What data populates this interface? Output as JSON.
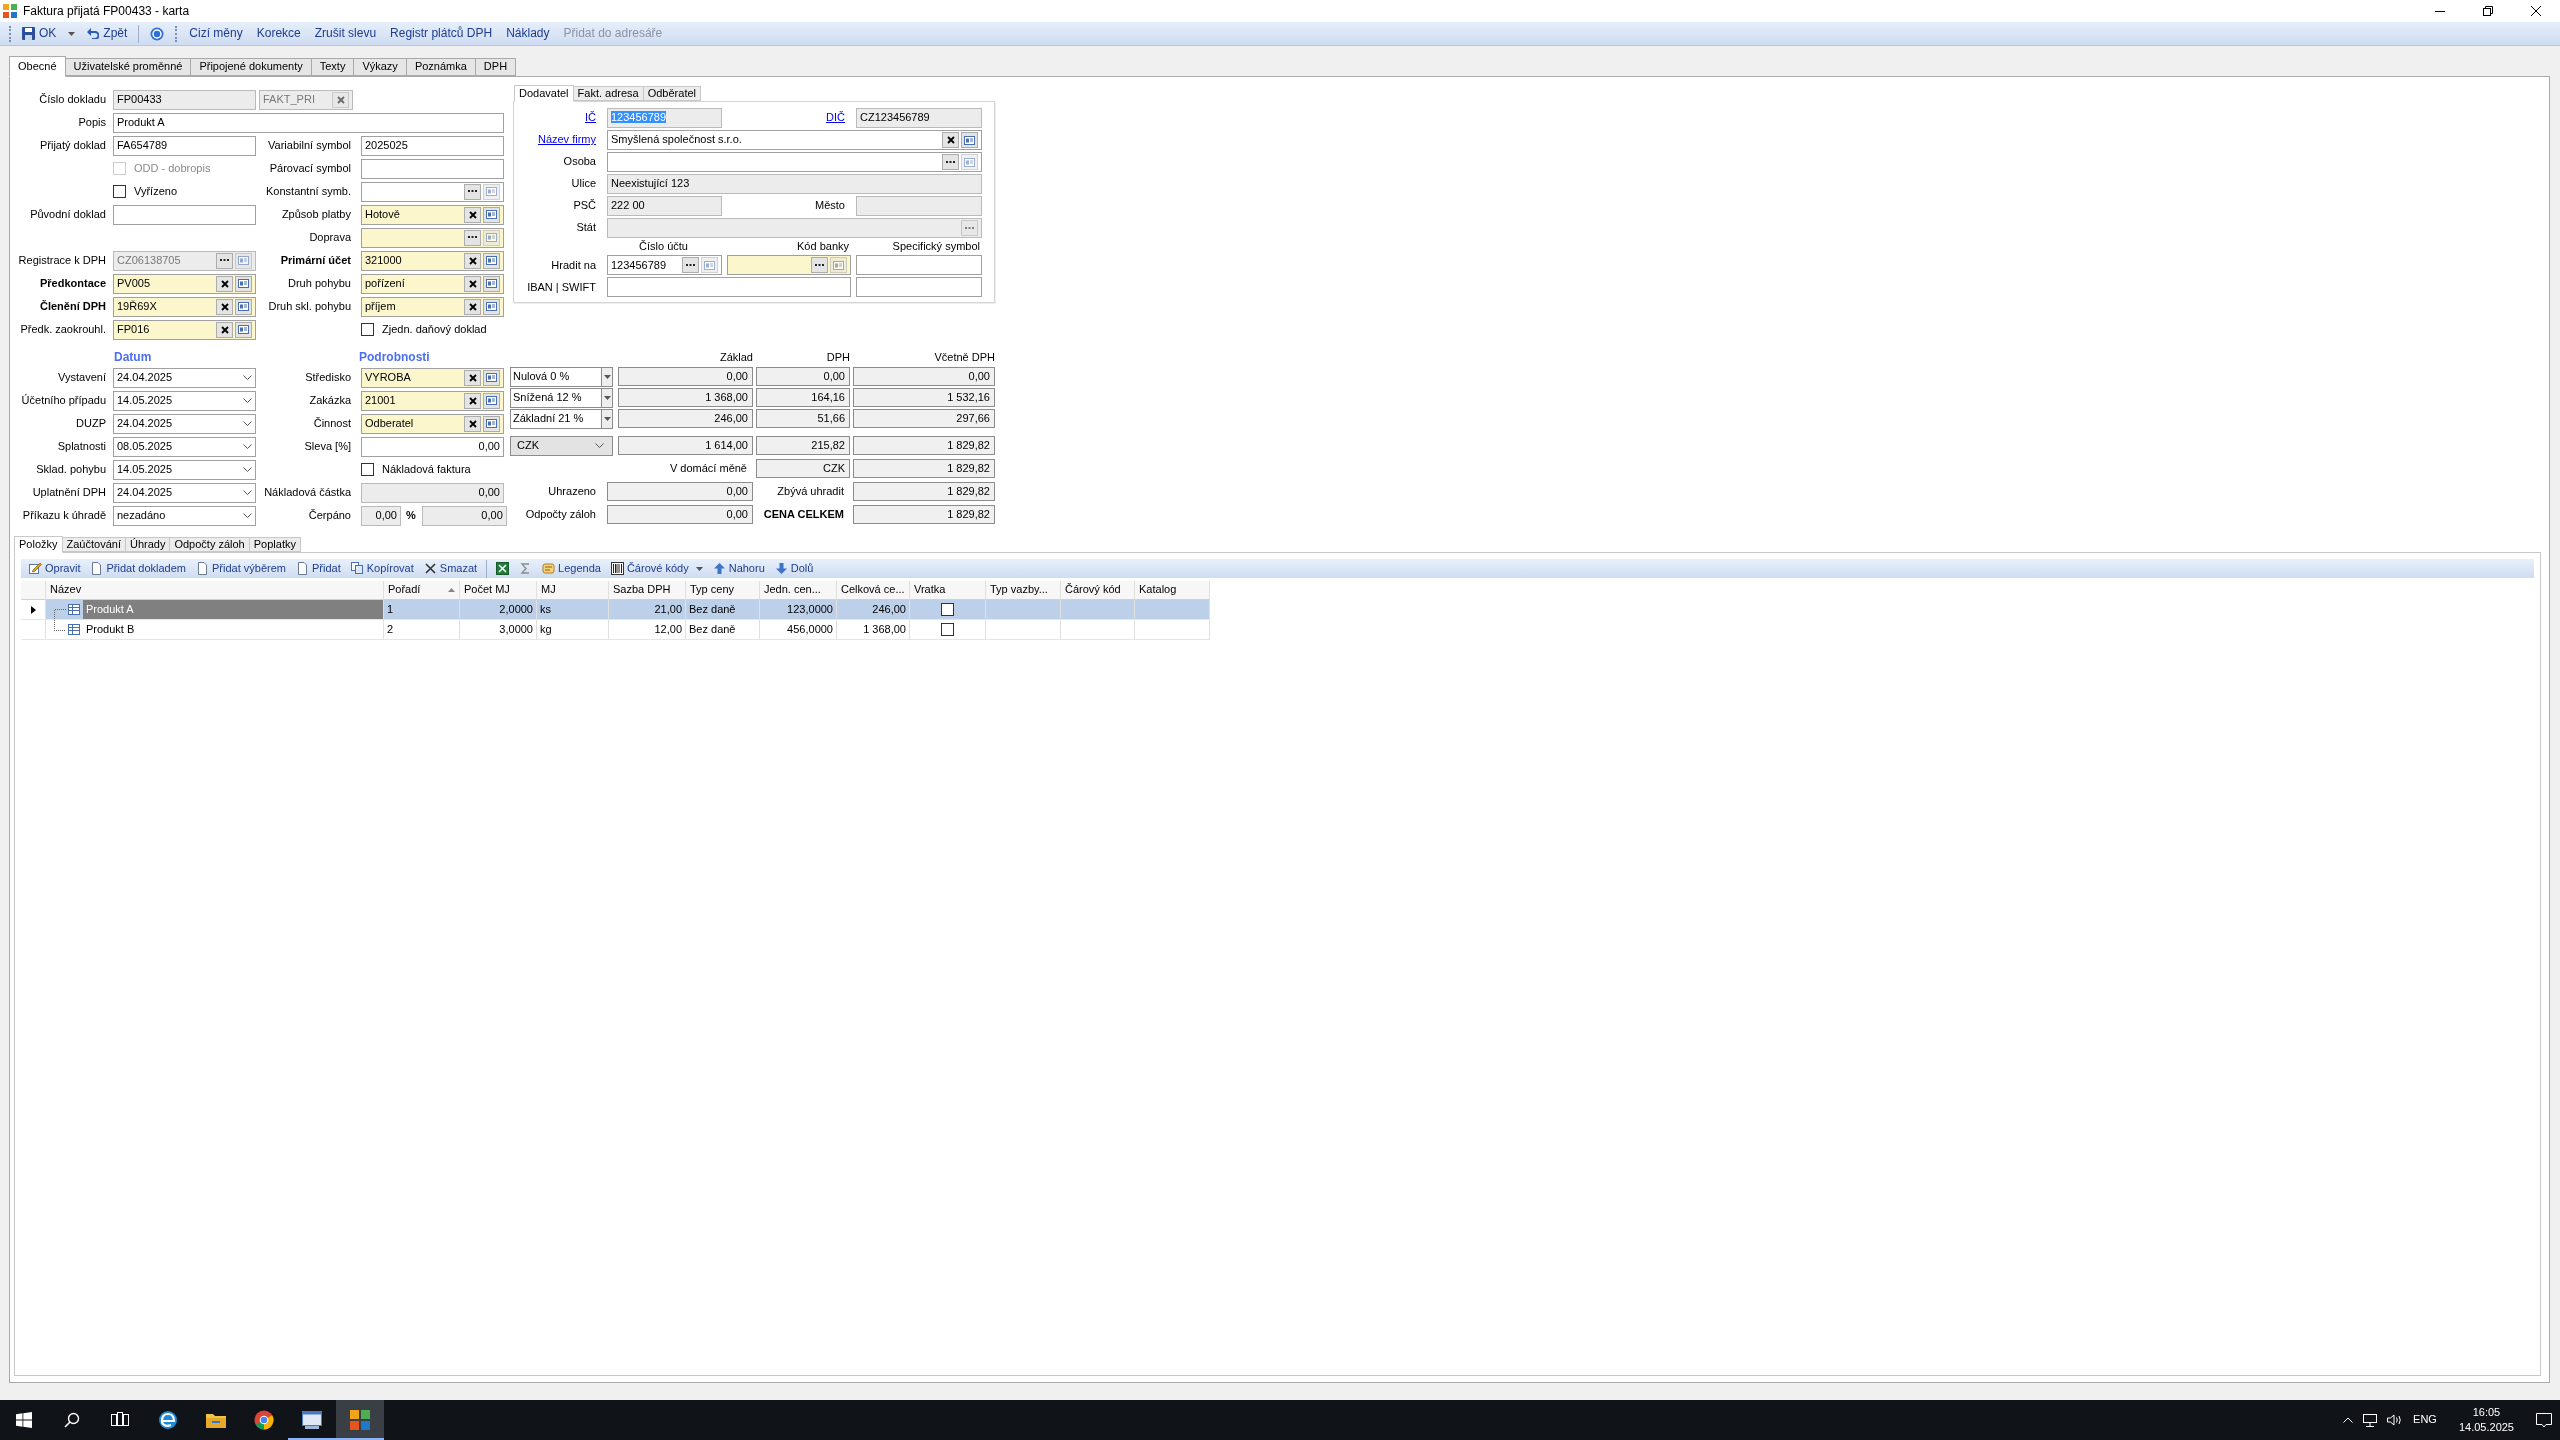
{
  "window": {
    "title": "Faktura přijatá FP00433 - karta"
  },
  "toolbar": {
    "items": [
      {
        "kind": "save",
        "label": "OK"
      },
      {
        "kind": "dropdown"
      },
      {
        "kind": "undo",
        "label": "Zpět"
      },
      {
        "kind": "help"
      }
    ],
    "actions": [
      {
        "label": "Cizí měny",
        "disabled": false
      },
      {
        "label": "Korekce",
        "disabled": false
      },
      {
        "label": "Zrušit slevu",
        "disabled": false
      },
      {
        "label": "Registr plátců DPH",
        "disabled": false
      },
      {
        "label": "Náklady",
        "disabled": false
      },
      {
        "label": "Přidat do adresáře",
        "disabled": true
      }
    ]
  },
  "tabs": [
    {
      "label": "Obecné",
      "selected": true
    },
    {
      "label": "Uživatelské proměnné",
      "selected": false
    },
    {
      "label": "Připojené dokumenty",
      "selected": false
    },
    {
      "label": "Texty",
      "selected": false
    },
    {
      "label": "Výkazy",
      "selected": false
    },
    {
      "label": "Poznámka",
      "selected": false
    },
    {
      "label": "DPH",
      "selected": false
    }
  ],
  "document": {
    "number": {
      "label": "Číslo dokladu",
      "value": "FP00433",
      "series": "FAKT_PRI"
    },
    "description": {
      "label": "Popis",
      "value": "Produkt A"
    },
    "rows": [
      {
        "left": {
          "label": "Přijatý doklad",
          "value": "FA654789",
          "kind": "text",
          "required": false,
          "readonly": false,
          "bold": false
        },
        "right": {
          "label": "Variabilní symbol",
          "value": "2025025",
          "kind": "text",
          "required": false,
          "readonly": false,
          "bold": false
        }
      },
      {
        "left": {
          "label": "ODD - dobropis",
          "kind": "checkbox",
          "checked": false,
          "disabled": true
        },
        "right": {
          "label": "Párovací symbol",
          "kind": "text",
          "required": false,
          "readonly": false,
          "bold": false
        }
      },
      {
        "left": {
          "label": "Vyřízeno",
          "kind": "checkbox",
          "checked": false,
          "disabled": false
        },
        "right": {
          "label": "Konstantní symb.",
          "kind": "browsable",
          "required": false,
          "readonly": false,
          "bold": false
        }
      },
      {
        "left": {
          "label": "Původní doklad",
          "kind": "text",
          "required": false,
          "readonly": false,
          "bold": false
        },
        "right": {
          "label": "Způsob platby",
          "value": "Hotově",
          "kind": "clearable",
          "required": true,
          "readonly": false,
          "bold": false
        }
      },
      {
        "right": {
          "label": "Doprava",
          "kind": "browsable",
          "required": true,
          "readonly": false,
          "bold": false
        }
      },
      {
        "left": {
          "label": "Registrace k DPH",
          "value": "CZ06138705",
          "kind": "browsable",
          "required": false,
          "readonly": true,
          "disabled": true,
          "bold": false
        },
        "right": {
          "label": "Primární účet",
          "value": "321000",
          "kind": "clearable",
          "required": true,
          "readonly": false,
          "bold": true
        }
      },
      {
        "left": {
          "label": "Předkontace",
          "value": "PV005",
          "kind": "clearable",
          "required": true,
          "readonly": false,
          "bold": true
        },
        "right": {
          "label": "Druh pohybu",
          "value": "pořízení",
          "kind": "clearable",
          "required": true,
          "readonly": false,
          "bold": false
        }
      },
      {
        "left": {
          "label": "Členění DPH",
          "value": "19Ř69X",
          "kind": "clearable",
          "required": true,
          "readonly": false,
          "bold": true
        },
        "right": {
          "label": "Druh skl. pohybu",
          "value": "příjem",
          "kind": "clearable",
          "required": true,
          "readonly": false,
          "bold": false
        }
      },
      {
        "left": {
          "label": "Předk. zaokrouhl.",
          "value": "FP016",
          "kind": "clearable",
          "required": true,
          "readonly": false,
          "bold": false
        },
        "right": {
          "label": "Zjedn. daňový doklad",
          "kind": "checkbox",
          "checked": false,
          "disabled": false
        }
      }
    ],
    "headings": [
      "Datum",
      "Podrobnosti"
    ],
    "detail_rows": [
      {
        "left": {
          "label": "Vystavení",
          "value": "24.04.2025",
          "kind": "date",
          "bold": false
        },
        "right": {
          "label": "Středisko",
          "value": "VYROBA",
          "kind": "clearable",
          "required": true,
          "readonly": false,
          "bold": false
        }
      },
      {
        "left": {
          "label": "Účetního případu",
          "value": "14.05.2025",
          "kind": "date",
          "bold": false
        },
        "right": {
          "label": "Zakázka",
          "value": "21001",
          "kind": "clearable",
          "required": true,
          "readonly": false,
          "bold": false
        }
      },
      {
        "left": {
          "label": "DUZP",
          "value": "24.04.2025",
          "kind": "date",
          "bold": false
        },
        "right": {
          "label": "Činnost",
          "value": "Odberatel",
          "kind": "clearable",
          "required": true,
          "readonly": false,
          "bold": false
        }
      },
      {
        "left": {
          "label": "Splatnosti",
          "value": "08.05.2025",
          "kind": "date",
          "bold": false
        },
        "right": {
          "label": "Sleva [%]",
          "value": "0,00",
          "kind": "number",
          "required": false,
          "readonly": false,
          "bold": false
        }
      },
      {
        "left": {
          "label": "Sklad. pohybu",
          "value": "14.05.2025",
          "kind": "date",
          "bold": false
        },
        "right": {
          "label": "Nákladová faktura",
          "kind": "checkbox",
          "checked": false,
          "disabled": false
        }
      },
      {
        "left": {
          "label": "Uplatnění DPH",
          "value": "24.04.2025",
          "kind": "date",
          "bold": false
        },
        "right": {
          "label": "Nákladová částka",
          "value": "0,00",
          "kind": "number",
          "required": false,
          "readonly": true,
          "bold": false
        }
      },
      {
        "left": {
          "label": "Příkazu k úhradě",
          "value": "nezadáno",
          "kind": "date",
          "bold": false
        },
        "right": {
          "label": "Čerpáno",
          "value": "0,00",
          "unit": "%",
          "amount": "0,00",
          "kind": "percent",
          "bold": false
        }
      }
    ]
  },
  "supplier_panel": {
    "tabs": [
      {
        "label": "Dodavatel",
        "selected": true
      },
      {
        "label": "Fakt. adresa",
        "selected": false
      },
      {
        "label": "Odběratel",
        "selected": false
      }
    ],
    "ic": {
      "label": "IČ",
      "value": "123456789",
      "kind": "text",
      "required": false,
      "readonly": true,
      "link": true,
      "highlighted": true
    },
    "dic": {
      "label": "DIČ",
      "value": "CZ123456789",
      "kind": "text",
      "required": false,
      "readonly": true,
      "link": true
    },
    "company": {
      "label": "Název firmy",
      "value": "Smyšlená společnost s.r.o.",
      "kind": "clearable",
      "required": false,
      "readonly": false,
      "link": true
    },
    "person": {
      "label": "Osoba",
      "kind": "browsable",
      "required": false,
      "readonly": false,
      "link": false
    },
    "street": {
      "label": "Ulice",
      "value": "Neexistující 123",
      "kind": "text",
      "required": false,
      "readonly": true,
      "link": false
    },
    "zip": {
      "label": "PSČ",
      "value": "222 00",
      "kind": "text",
      "required": false,
      "readonly": true,
      "link": false
    },
    "city": {
      "label": "Město",
      "kind": "text",
      "required": false,
      "readonly": true,
      "link": false
    },
    "country": {
      "label": "Stát",
      "kind": "ellipsis",
      "required": false,
      "readonly": true,
      "link": false
    },
    "bank_headers": [
      "Číslo účtu",
      "Kód banky",
      "Specifický symbol"
    ],
    "pay_to": {
      "label": "Hradit na",
      "account": {
        "value": "123456789",
        "kind": "browsable",
        "required": false,
        "readonly": false
      },
      "bank_code": {
        "kind": "browsable",
        "required": true,
        "readonly": false
      },
      "specific_symbol": {
        "kind": "text",
        "required": false,
        "readonly": false
      }
    },
    "iban_swift": {
      "label": "IBAN | SWIFT",
      "iban": {
        "kind": "text",
        "required": false,
        "readonly": false
      },
      "swift": {
        "kind": "text",
        "required": false,
        "readonly": false
      }
    }
  },
  "vat_summary": {
    "headers": [
      "Základ",
      "DPH",
      "Včetně DPH"
    ],
    "rates": [
      {
        "rate": "Nulová 0 %",
        "base": "0,00",
        "vat": "0,00",
        "total": "0,00"
      },
      {
        "rate": "Snížená 12 %",
        "base": "1 368,00",
        "vat": "164,16",
        "total": "1 532,16"
      },
      {
        "rate": "Základní 21 %",
        "base": "246,00",
        "vat": "51,66",
        "total": "297,66"
      }
    ],
    "sum": {
      "currency": "CZK",
      "base": "1 614,00",
      "vat": "215,82",
      "total": "1 829,82"
    },
    "domestic": {
      "label": "V domácí měně",
      "currency": "CZK",
      "total": "1 829,82"
    },
    "paid": {
      "label": "Uhrazeno",
      "value": "0,00",
      "remaining_label": "Zbývá uhradit",
      "remaining": "1 829,82"
    },
    "advances": {
      "label": "Odpočty záloh",
      "value": "0,00",
      "total_label": "CENA CELKEM",
      "total": "1 829,82"
    }
  },
  "bottom_tabs": [
    {
      "label": "Položky",
      "selected": true
    },
    {
      "label": "Zaúčtování",
      "selected": false
    },
    {
      "label": "Úhrady",
      "selected": false
    },
    {
      "label": "Odpočty záloh",
      "selected": false
    },
    {
      "label": "Poplatky",
      "selected": false
    }
  ],
  "items_toolbar": [
    {
      "kind": "edit",
      "label": "Opravit"
    },
    {
      "kind": "document",
      "label": "Přidat dokladem"
    },
    {
      "kind": "document",
      "label": "Přidat výběrem"
    },
    {
      "kind": "document",
      "label": "Přidat"
    },
    {
      "kind": "copy",
      "label": "Kopírovat"
    },
    {
      "kind": "delete",
      "label": "Smazat"
    },
    {
      "kind": "spreadsheet"
    },
    {
      "kind": "sigma"
    },
    {
      "kind": "legend",
      "label": "Legenda"
    },
    {
      "kind": "barcode",
      "label": "Čárové kódy"
    },
    {
      "kind": "up",
      "label": "Nahoru"
    },
    {
      "kind": "down",
      "label": "Dolů"
    }
  ],
  "items_table": {
    "columns": [
      {
        "label": "Název",
        "sorted": false
      },
      {
        "label": "Pořadí",
        "sorted": true
      },
      {
        "label": "Počet MJ",
        "sorted": false
      },
      {
        "label": "MJ",
        "sorted": false
      },
      {
        "label": "Sazba DPH",
        "sorted": false
      },
      {
        "label": "Typ ceny",
        "sorted": false
      },
      {
        "label": "Jedn. cen...",
        "sorted": false
      },
      {
        "label": "Celková ce...",
        "sorted": false
      },
      {
        "label": "Vratka",
        "sorted": false
      },
      {
        "label": "Typ vazby...",
        "sorted": false
      },
      {
        "label": "Čárový kód",
        "sorted": false
      },
      {
        "label": "Katalog",
        "sorted": false
      }
    ],
    "rows": [
      {
        "selected": true,
        "cells": [
          "Produkt A",
          "1",
          "2,0000",
          "ks",
          "21,00",
          "Bez daně",
          "123,0000",
          "246,00"
        ],
        "returned": false
      },
      {
        "selected": false,
        "cells": [
          "Produkt B",
          "2",
          "3,0000",
          "kg",
          "12,00",
          "Bez daně",
          "456,0000",
          "1 368,00"
        ],
        "returned": false
      }
    ]
  },
  "taskbar": {
    "apps": [
      {
        "kind": "start",
        "open": false,
        "selected": false
      },
      {
        "kind": "search",
        "open": false,
        "selected": false
      },
      {
        "kind": "taskview",
        "open": false,
        "selected": false
      },
      {
        "kind": "edge",
        "open": false,
        "selected": false
      },
      {
        "kind": "explorer",
        "open": false,
        "selected": false
      },
      {
        "kind": "chrome",
        "open": false,
        "selected": false
      },
      {
        "kind": "app",
        "open": true,
        "selected": false
      },
      {
        "kind": "puzzle",
        "open": true,
        "selected": true
      }
    ],
    "tray": {
      "language": "ENG",
      "time": "16:05",
      "date": "14.05.2025"
    }
  }
}
